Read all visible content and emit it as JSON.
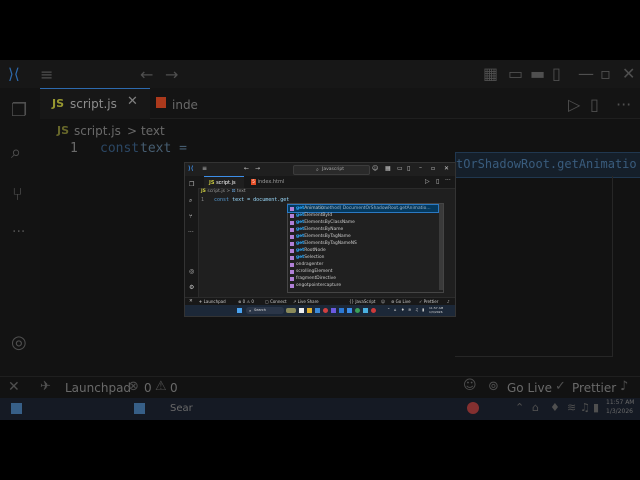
{
  "window": {
    "search_placeholder": "Javascript"
  },
  "tabs": [
    {
      "label": "script.js",
      "icon": "JS"
    },
    {
      "label": "index.html",
      "icon": "5"
    }
  ],
  "breadcrumb": {
    "file": "script.js",
    "separator": ">",
    "symbol": "text"
  },
  "editor": {
    "line_number": "1",
    "keyword": "const",
    "code": "text = document.get"
  },
  "suggestions": {
    "typed": "get",
    "items": [
      {
        "rest": "Animatio…",
        "detail": "(method) DocumentOrShadowRoot.getAnimatio…"
      },
      {
        "rest": "ElementById"
      },
      {
        "rest": "ElementsByClassName"
      },
      {
        "rest": "ElementsByName"
      },
      {
        "rest": "ElementsByTagName"
      },
      {
        "rest": "ElementsByTagNameNS"
      },
      {
        "rest": "RootNode"
      },
      {
        "rest": "Selection"
      },
      {
        "label": "ondragenter"
      },
      {
        "label": "scrollingElement"
      },
      {
        "label": "fragmentDirective"
      },
      {
        "label": "ongotpointercapture"
      }
    ]
  },
  "status": {
    "launchpad": "Launchpad",
    "errors": "0",
    "warnings": "0",
    "connect": "Connect",
    "live_share": "Live Share",
    "language": "JavaScript",
    "go_live": "Go Live",
    "prettier": "Prettier"
  },
  "taskbar": {
    "search": "Search",
    "time": "11:57 AM",
    "date": "1/3/2026"
  },
  "background": {
    "tab_label": "script.js",
    "tab_partial": "inde",
    "crumb_file": "script.js",
    "crumb_symbol": "text",
    "line_number": "1",
    "code_keyword": "const",
    "code_var": "text =",
    "hint_fragment": "tOrShadowRoot.getAnimatio",
    "launchpad": "Launchpad",
    "err_count": "0",
    "warn_count": "0",
    "go_live": "Go Live",
    "prettier": "Prettier",
    "search_partial": "Sear",
    "time": "11:57 AM",
    "date": "1/3/2026"
  },
  "colors": {
    "accent": "#3d8ee8",
    "keyword": "#569cd6",
    "match": "#2aaaff",
    "selected": "#04395e"
  }
}
